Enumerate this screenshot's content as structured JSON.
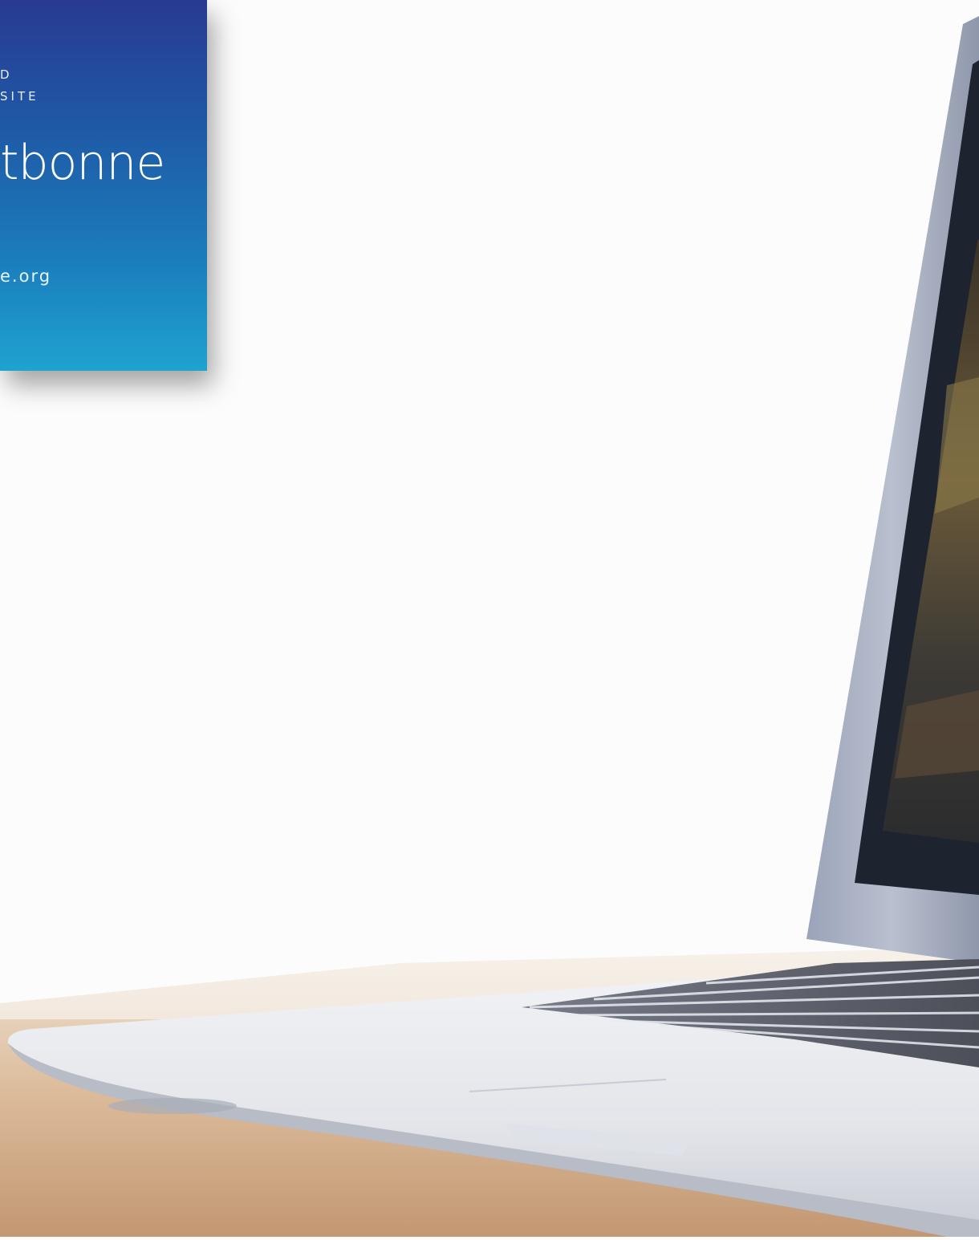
{
  "card": {
    "eyebrow": "D\nSITE",
    "title": "tbonne",
    "url": "e.org",
    "gradient_colors": [
      "#283a93",
      "#1f5aa6",
      "#1b7dbd",
      "#1ea3cf"
    ]
  },
  "photo": {
    "subject": "laptop-on-wooden-desk"
  }
}
